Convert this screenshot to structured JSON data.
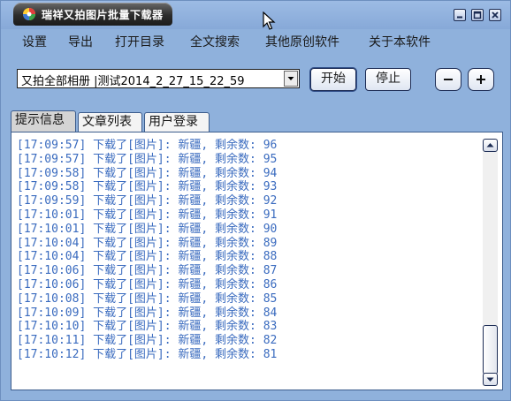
{
  "window": {
    "title": "瑞祥又拍图片批量下载器"
  },
  "menu": {
    "items": [
      "设置",
      "导出",
      "打开目录",
      "全文搜索",
      "其他原创软件",
      "关于本软件"
    ]
  },
  "toolbar": {
    "album_combo_value": "又拍全部相册 |测试2014_2_27_15_22_59",
    "start_label": "开始",
    "stop_label": "停止",
    "minus_label": "−",
    "plus_label": "+"
  },
  "tabs": [
    "提示信息",
    "文章列表",
    "用户登录"
  ],
  "active_tab": "提示信息",
  "log": {
    "lines": [
      "[17:09:57] 下载了[图片]: 新疆, 剩余数: 96",
      "[17:09:57] 下载了[图片]: 新疆, 剩余数: 95",
      "[17:09:58] 下载了[图片]: 新疆, 剩余数: 94",
      "[17:09:58] 下载了[图片]: 新疆, 剩余数: 93",
      "[17:09:59] 下载了[图片]: 新疆, 剩余数: 92",
      "[17:10:01] 下载了[图片]: 新疆, 剩余数: 91",
      "[17:10:01] 下载了[图片]: 新疆, 剩余数: 90",
      "[17:10:04] 下载了[图片]: 新疆, 剩余数: 89",
      "[17:10:04] 下载了[图片]: 新疆, 剩余数: 88",
      "[17:10:06] 下载了[图片]: 新疆, 剩余数: 87",
      "[17:10:06] 下载了[图片]: 新疆, 剩余数: 86",
      "[17:10:08] 下载了[图片]: 新疆, 剩余数: 85",
      "[17:10:09] 下载了[图片]: 新疆, 剩余数: 84",
      "[17:10:10] 下载了[图片]: 新疆, 剩余数: 83",
      "[17:10:11] 下载了[图片]: 新疆, 剩余数: 82",
      "[17:10:12] 下载了[图片]: 新疆, 剩余数: 81"
    ]
  },
  "colors": {
    "window_bg": "#8fb1dc",
    "log_text": "#3a6bbf"
  },
  "icons": {
    "app": "app-icon",
    "cursor": "mouse-cursor-icon",
    "minimize": "minimize-icon",
    "maximize": "maximize-icon",
    "close": "close-icon"
  }
}
